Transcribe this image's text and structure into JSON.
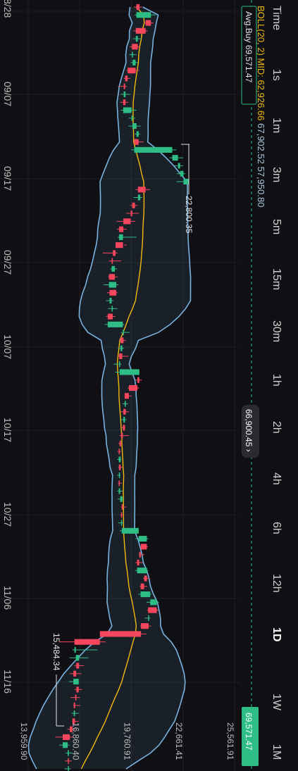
{
  "intervals": {
    "label": "Time",
    "items": [
      "1s",
      "1m",
      "3m",
      "5m",
      "15m",
      "30m",
      "1h",
      "2h",
      "4h",
      "6h",
      "12h",
      "1D",
      "1W",
      "1M"
    ],
    "selected": "1D"
  },
  "indicator": {
    "name": "BOLL(20, 2)",
    "mid_label": "MID:",
    "mid": "62,926.66",
    "upper": "67,902.52",
    "lower": "57,950.80"
  },
  "avg_buy": {
    "label": "Avg.Buy",
    "value": "69,571.47"
  },
  "current_price_badge": "69,571.47",
  "last_price_pill": "66,900.45",
  "price_axis": {
    "labels": [
      "13,959.90",
      "16,860.40",
      "19,760.91",
      "22,661.41",
      "25,561.91"
    ]
  },
  "date_axis": {
    "labels": [
      "8/28",
      "09/07",
      "09/17",
      "09/27",
      "10/07",
      "10/17",
      "10/27",
      "11/06",
      "11/16"
    ]
  },
  "annotations": {
    "high": "22,800.35",
    "low": "15,484.34"
  },
  "colors": {
    "up": "#2ebd85",
    "down": "#f6465d",
    "band": "#78b2e0",
    "mid": "#f0b90b",
    "avg_buy": "#2ebd85",
    "background": "#101014"
  },
  "chart_data": {
    "type": "candlestick",
    "orientation": "rotated-90-clockwise",
    "price_range": [
      13959.9,
      25561.91
    ],
    "x_dates": [
      "8/28",
      "09/07",
      "09/17",
      "09/27",
      "10/07",
      "10/17",
      "10/27",
      "11/06",
      "11/16"
    ],
    "candles_ohlc": [
      [
        20220,
        20360,
        19900,
        20040
      ],
      [
        20040,
        21120,
        19940,
        20860
      ],
      [
        20860,
        21000,
        20480,
        20560
      ],
      [
        20560,
        20680,
        19880,
        20010
      ],
      [
        20010,
        20330,
        19840,
        20120
      ],
      [
        20120,
        20260,
        19670,
        19790
      ],
      [
        19790,
        20040,
        19640,
        19830
      ],
      [
        19830,
        20120,
        19720,
        20000
      ],
      [
        20000,
        20190,
        19490,
        19550
      ],
      [
        19550,
        19700,
        19330,
        19410
      ],
      [
        19410,
        19510,
        19020,
        19330
      ],
      [
        19330,
        19700,
        19160,
        19430
      ],
      [
        19430,
        19600,
        19140,
        19300
      ],
      [
        19300,
        20040,
        19160,
        19770
      ],
      [
        19770,
        19990,
        19610,
        19820
      ],
      [
        19820,
        20280,
        19590,
        20050
      ],
      [
        20050,
        20260,
        19950,
        20170
      ],
      [
        20170,
        20450,
        19840,
        19920
      ],
      [
        19920,
        22300,
        19750,
        22060
      ],
      [
        22060,
        22660,
        21900,
        22380
      ],
      [
        22380,
        22670,
        22180,
        22500
      ],
      [
        22500,
        22800,
        22320,
        22690
      ],
      [
        22690,
        22800,
        22300,
        22970
      ],
      [
        20560,
        20810,
        20000,
        20130
      ],
      [
        20130,
        20370,
        19880,
        20260
      ],
      [
        19960,
        20100,
        19700,
        19810
      ],
      [
        19810,
        20180,
        19480,
        19720
      ],
      [
        19720,
        19990,
        18930,
        19310
      ],
      [
        19310,
        19500,
        18950,
        19070
      ],
      [
        19070,
        20050,
        19000,
        19290
      ],
      [
        19290,
        19500,
        19350,
        18870
      ],
      [
        18870,
        18980,
        18150,
        18720
      ],
      [
        18720,
        19200,
        18500,
        18650
      ],
      [
        18650,
        18960,
        18580,
        18830
      ],
      [
        18830,
        18990,
        18450,
        18500
      ],
      [
        18500,
        19040,
        18200,
        18910
      ],
      [
        18910,
        18990,
        18390,
        18530
      ],
      [
        18530,
        18750,
        18330,
        18650
      ],
      [
        18650,
        18980,
        18450,
        18710
      ],
      [
        18710,
        18860,
        18340,
        18430
      ],
      [
        18430,
        19360,
        18260,
        19280
      ],
      [
        19280,
        19650,
        19180,
        19320
      ],
      [
        19320,
        19450,
        19080,
        19150
      ],
      [
        19150,
        19350,
        19010,
        19250
      ],
      [
        19250,
        19600,
        19000,
        19070
      ],
      [
        19070,
        19200,
        18760,
        19100
      ],
      [
        19100,
        20110,
        18850,
        20210
      ],
      [
        20210,
        20350,
        19970,
        20100
      ],
      [
        20100,
        20200,
        19550,
        19620
      ],
      [
        19620,
        19780,
        19400,
        19380
      ],
      [
        19380,
        19570,
        19260,
        19450
      ],
      [
        19450,
        19630,
        19160,
        19310
      ],
      [
        19310,
        19480,
        19170,
        19400
      ],
      [
        19400,
        19420,
        19200,
        19280
      ],
      [
        19280,
        19620,
        19100,
        19180
      ],
      [
        19180,
        19270,
        19020,
        19100
      ],
      [
        19100,
        19180,
        18970,
        19050
      ],
      [
        19050,
        19200,
        18960,
        19160
      ],
      [
        19160,
        19280,
        19010,
        19060
      ],
      [
        19060,
        19150,
        18950,
        19100
      ],
      [
        19100,
        19220,
        19000,
        19050
      ],
      [
        19050,
        19290,
        18960,
        19130
      ],
      [
        19130,
        19360,
        19000,
        19260
      ],
      [
        19260,
        19470,
        19170,
        19220
      ],
      [
        19220,
        19330,
        19130,
        19180
      ],
      [
        19180,
        19320,
        19010,
        19220
      ],
      [
        19220,
        20000,
        19100,
        20170
      ],
      [
        20170,
        20710,
        19990,
        20630
      ],
      [
        20630,
        20700,
        20250,
        20290
      ],
      [
        20290,
        20490,
        20250,
        20200
      ],
      [
        20200,
        20400,
        19990,
        20080
      ],
      [
        20080,
        20700,
        19970,
        20640
      ],
      [
        20640,
        20800,
        20420,
        20480
      ],
      [
        20480,
        20650,
        20230,
        20280
      ],
      [
        20280,
        20890,
        20150,
        20820
      ],
      [
        20820,
        21300,
        20610,
        21190
      ],
      [
        21190,
        21290,
        20650,
        20700
      ],
      [
        20700,
        20830,
        20510,
        20730
      ],
      [
        20730,
        20880,
        20250,
        20300
      ],
      [
        20300,
        20600,
        19880,
        17990
      ],
      [
        17990,
        18310,
        15710,
        16560
      ],
      [
        16560,
        17850,
        16450,
        16640
      ],
      [
        16640,
        17350,
        16280,
        16820
      ],
      [
        16820,
        17090,
        16550,
        16660
      ],
      [
        16660,
        16950,
        16300,
        16500
      ],
      [
        16500,
        16820,
        16250,
        16800
      ],
      [
        16800,
        16990,
        16570,
        16670
      ],
      [
        16670,
        16870,
        16340,
        16600
      ],
      [
        16600,
        16880,
        16480,
        16520
      ],
      [
        16520,
        16800,
        16400,
        16590
      ],
      [
        16590,
        16790,
        16420,
        16450
      ],
      [
        16450,
        16610,
        16160,
        16300
      ],
      [
        16300,
        16500,
        15484,
        15900
      ],
      [
        15900,
        16290,
        15700,
        16180
      ],
      [
        16180,
        16470,
        16050,
        16250
      ],
      [
        16250,
        16400,
        16030,
        16190
      ],
      [
        16190,
        16350,
        16000,
        16240
      ]
    ],
    "bollinger": {
      "period": 20,
      "multiplier": 2
    }
  }
}
